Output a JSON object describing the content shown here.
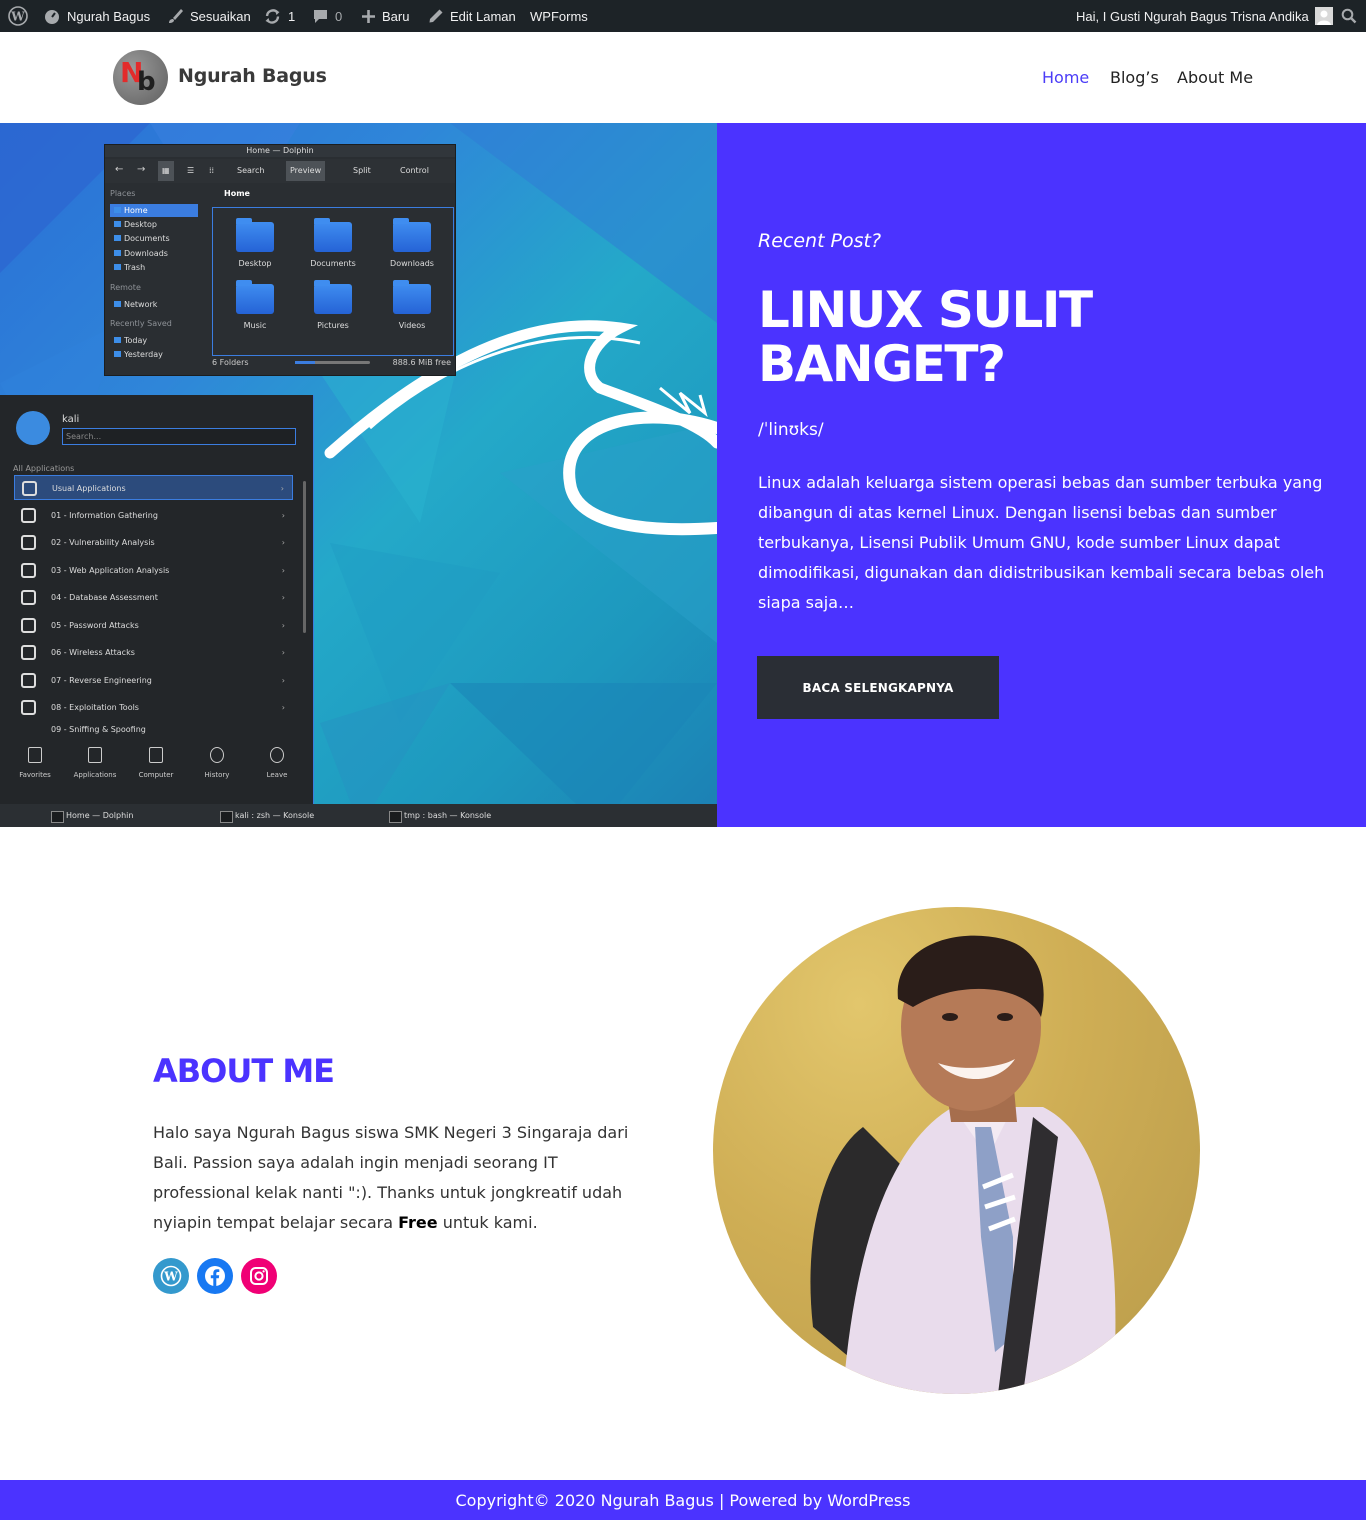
{
  "admin_bar": {
    "site_name": "Ngurah Bagus",
    "customize": "Sesuaikan",
    "updates_count": "1",
    "comments_count": "0",
    "new_label": "Baru",
    "edit_page": "Edit Laman",
    "wpforms": "WPForms",
    "greeting": "Hai, I Gusti Ngurah Bagus Trisna Andika"
  },
  "header": {
    "logo_letters": {
      "n": "N",
      "b": "b"
    },
    "site_title": "Ngurah Bagus",
    "nav": [
      {
        "label": "Home",
        "active": true
      },
      {
        "label": "Blog’s",
        "active": false
      },
      {
        "label": "About Me",
        "active": false
      }
    ]
  },
  "hero": {
    "eyebrow": "Recent Post?",
    "title_line1": "LINUX SULIT",
    "title_line2": "BANGET?",
    "phonetic": "/ˈlinʊks/",
    "body": "Linux adalah keluarga sistem operasi bebas dan sumber terbuka yang dibangun di atas kernel Linux. Dengan lisensi bebas dan sumber terbukanya, Lisensi Publik Umum GNU, kode sumber Linux dapat dimodifikasi, digunakan dan didistribusikan kembali secara bebas oleh siapa saja…",
    "button": "BACA SELENGKAPNYA",
    "accent_color": "#4b33ff"
  },
  "screenshot": {
    "dolphin": {
      "title": "Home — Dolphin",
      "toolbar": [
        "Search",
        "Preview",
        "Split",
        "Control"
      ],
      "breadcrumb": "Home",
      "places_label": "Places",
      "places": [
        "Home",
        "Desktop",
        "Documents",
        "Downloads",
        "Trash"
      ],
      "remote_label": "Remote",
      "remote": [
        "Network"
      ],
      "recent_label": "Recently Saved",
      "recent": [
        "Today",
        "Yesterday"
      ],
      "folders": [
        "Desktop",
        "Documents",
        "Downloads",
        "Music",
        "Pictures",
        "Videos"
      ],
      "status": "6 Folders",
      "free": "888.6 MiB free"
    },
    "kali_menu": {
      "user": "kali",
      "search_placeholder": "Search...",
      "all_apps": "All Applications",
      "items": [
        "Usual Applications",
        "01 - Information Gathering",
        "02 - Vulnerability Analysis",
        "03 - Web Application Analysis",
        "04 - Database Assessment",
        "05 - Password Attacks",
        "06 - Wireless Attacks",
        "07 - Reverse Engineering",
        "08 - Exploitation Tools",
        "09 - Sniffing & Spoofing"
      ],
      "footer": [
        "Favorites",
        "Applications",
        "Computer",
        "History",
        "Leave"
      ]
    },
    "taskbar": [
      "Home — Dolphin",
      "kali : zsh — Konsole",
      "tmp : bash — Konsole"
    ]
  },
  "about": {
    "title": "ABOUT ME",
    "body_before": "Halo saya Ngurah Bagus siswa SMK Negeri 3 Singaraja dari Bali. Passion saya adalah ingin menjadi seorang IT professional kelak nanti \":). Thanks untuk jongkreatif udah nyiapin tempat belajar secara ",
    "body_bold": "Free",
    "body_after": " untuk kami.",
    "social": [
      {
        "name": "wordpress-icon",
        "color": "#3499cd"
      },
      {
        "name": "facebook-icon",
        "color": "#1778f2"
      },
      {
        "name": "instagram-icon",
        "color": "#f00075"
      }
    ]
  },
  "footer": {
    "text": "Copyright© 2020 Ngurah Bagus | Powered by WordPress"
  }
}
